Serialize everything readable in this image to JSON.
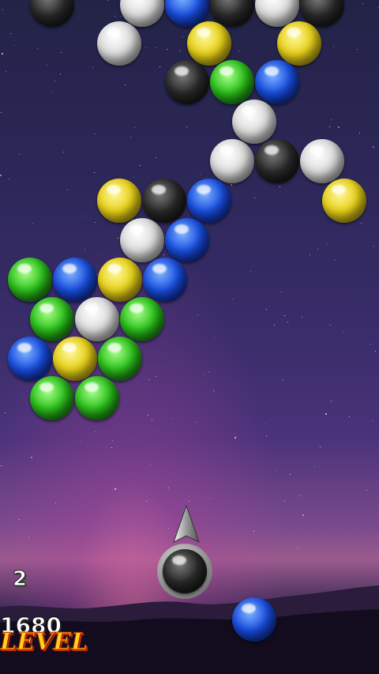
{
  "hud": {
    "shots_left": "2",
    "score": "1680",
    "level_label": "LEVEL"
  },
  "colors": {
    "black": "#1a1a1a",
    "white": "#d8d8d8",
    "blue": "#1a4fe0",
    "yellow": "#e8d21a",
    "green": "#2cc21c"
  },
  "board": {
    "bubble_colors": [
      "black",
      "white",
      "blue",
      "black",
      "white",
      "black",
      "white",
      "yellow",
      "yellow",
      "black",
      "green",
      "blue",
      "white",
      "white",
      "black",
      "white",
      "yellow",
      "black",
      "blue",
      "yellow",
      "white",
      "blue",
      "green",
      "blue",
      "yellow",
      "blue",
      "green",
      "white",
      "green",
      "blue",
      "yellow",
      "green",
      "green",
      "green"
    ]
  },
  "shooter": {
    "loaded_color": "black",
    "next_color": "blue"
  }
}
